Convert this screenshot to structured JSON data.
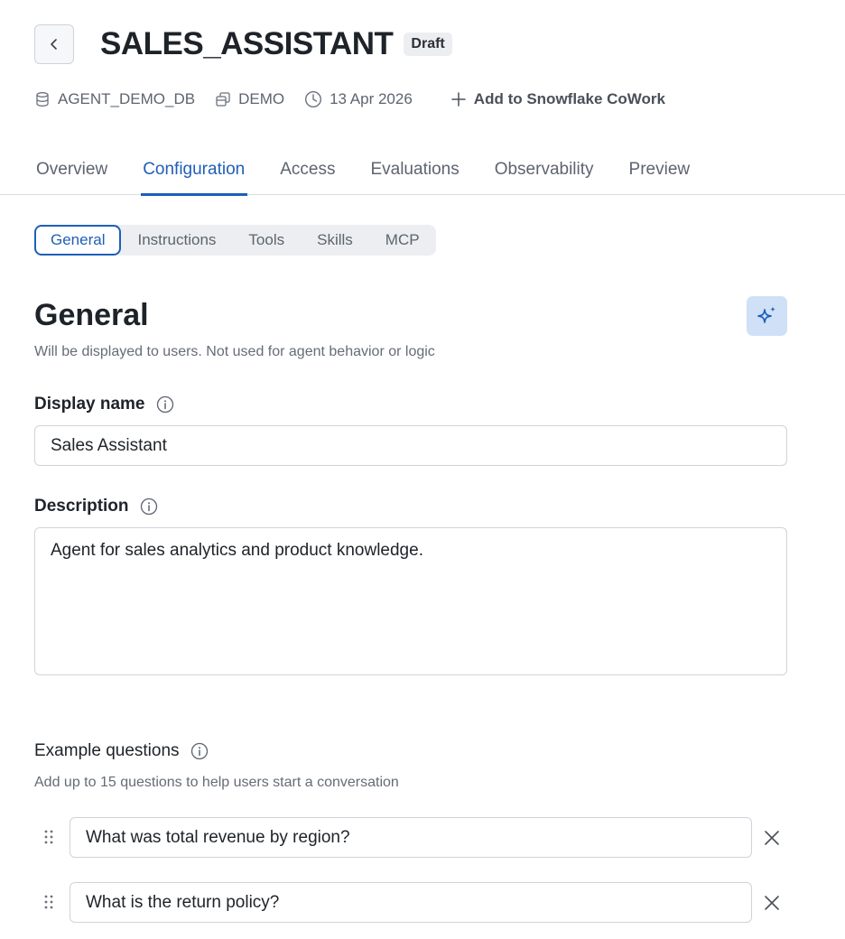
{
  "header": {
    "title": "SALES_ASSISTANT",
    "badge": "Draft",
    "meta": {
      "database": "AGENT_DEMO_DB",
      "schema": "DEMO",
      "date": "13 Apr 2026",
      "add_action": "Add to Snowflake CoWork"
    }
  },
  "tabs": [
    {
      "label": "Overview",
      "active": false
    },
    {
      "label": "Configuration",
      "active": true
    },
    {
      "label": "Access",
      "active": false
    },
    {
      "label": "Evaluations",
      "active": false
    },
    {
      "label": "Observability",
      "active": false
    },
    {
      "label": "Preview",
      "active": false
    }
  ],
  "subtabs": [
    {
      "label": "General",
      "active": true
    },
    {
      "label": "Instructions",
      "active": false
    },
    {
      "label": "Tools",
      "active": false
    },
    {
      "label": "Skills",
      "active": false
    },
    {
      "label": "MCP",
      "active": false
    }
  ],
  "general": {
    "title": "General",
    "subtitle": "Will be displayed to users. Not used for agent behavior or logic",
    "display_name_label": "Display name",
    "display_name_value": "Sales Assistant",
    "description_label": "Description",
    "description_value": "Agent for sales analytics and product knowledge."
  },
  "example_questions": {
    "label": "Example questions",
    "subtitle": "Add up to 15 questions to help users start a conversation",
    "items": [
      "What was total revenue by region?",
      "What is the return policy?"
    ]
  },
  "colors": {
    "accent": "#1f5fb8",
    "ai_button_bg": "#cfe0f7"
  }
}
